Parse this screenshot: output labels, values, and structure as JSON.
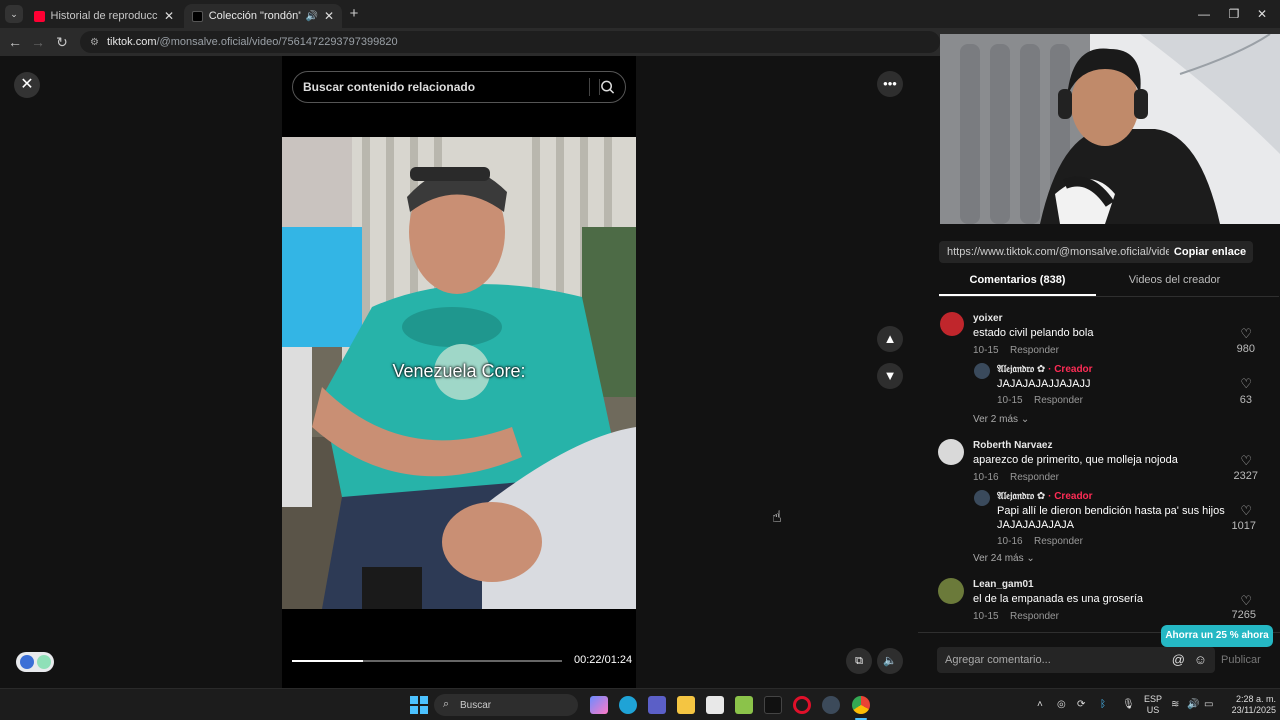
{
  "browser": {
    "tabs": [
      {
        "title": "Historial de reproducciones - YouTube",
        "active": false,
        "favicon_color": "#ff0033"
      },
      {
        "title": "Colección \"rondón\" creada por",
        "active": true,
        "favicon_color": "#000000"
      }
    ],
    "new_tab_symbol": "+",
    "window_controls": [
      "—",
      "❐",
      "✕"
    ],
    "url_host": "tiktok.com",
    "url_path": "/@monsalve.oficial/video/7561472293797399820"
  },
  "player": {
    "search_placeholder": "Buscar contenido relacionado",
    "caption": "Venezuela Core:",
    "time": "00:22/01:24",
    "progress": 0.262
  },
  "panel": {
    "share_link": "https://www.tiktok.com/@monsalve.oficial/video/...",
    "copy_link_label": "Copiar enlace",
    "tabs": [
      "Comentarios (838)",
      "Videos del creador"
    ],
    "comments": [
      {
        "user": "yoixer",
        "text": "estado civil pelando bola",
        "date": "10-15",
        "reply": "Responder",
        "likes": "980",
        "avatar_color": "#c0262c"
      },
      {
        "user": "𝔄𝔩𝔢𝔧𝔞𝔫𝔡𝔯𝔬 ✿",
        "creator": "· Creador",
        "text": "JAJAJAJAJJAJAJJ",
        "date": "10-15",
        "reply": "Responder",
        "likes": "63",
        "avatar_color": "#3a4a5c"
      },
      {
        "user": "Roberth Narvaez",
        "text": "aparezco de primerito, que molleja nojoda",
        "date": "10-16",
        "reply": "Responder",
        "likes": "2327",
        "avatar_color": "#d9d9d9"
      },
      {
        "user": "𝔄𝔩𝔢𝔧𝔞𝔫𝔡𝔯𝔬 ✿",
        "creator": "· Creador",
        "text": "Papi allí le dieron bendición hasta pa' sus hijos JAJAJAJAJAJA",
        "date": "10-16",
        "reply": "Responder",
        "likes": "1017",
        "avatar_color": "#3a4a5c"
      },
      {
        "user": "Lean_gam01",
        "text": "el de la empanada es una grosería",
        "date": "10-15",
        "reply": "Responder",
        "likes": "7265",
        "avatar_color": "#6b7a3a"
      }
    ],
    "more_replies": [
      "Ver 2 más",
      "Ver 24 más"
    ],
    "promo": "Ahorra un 25 % ahora",
    "comment_placeholder": "Agregar comentario...",
    "publish_label": "Publicar"
  },
  "taskbar": {
    "search_placeholder": "Buscar",
    "language": "ESP",
    "region": "US",
    "time": "2:28 a. m.",
    "date": "23/11/2025"
  }
}
